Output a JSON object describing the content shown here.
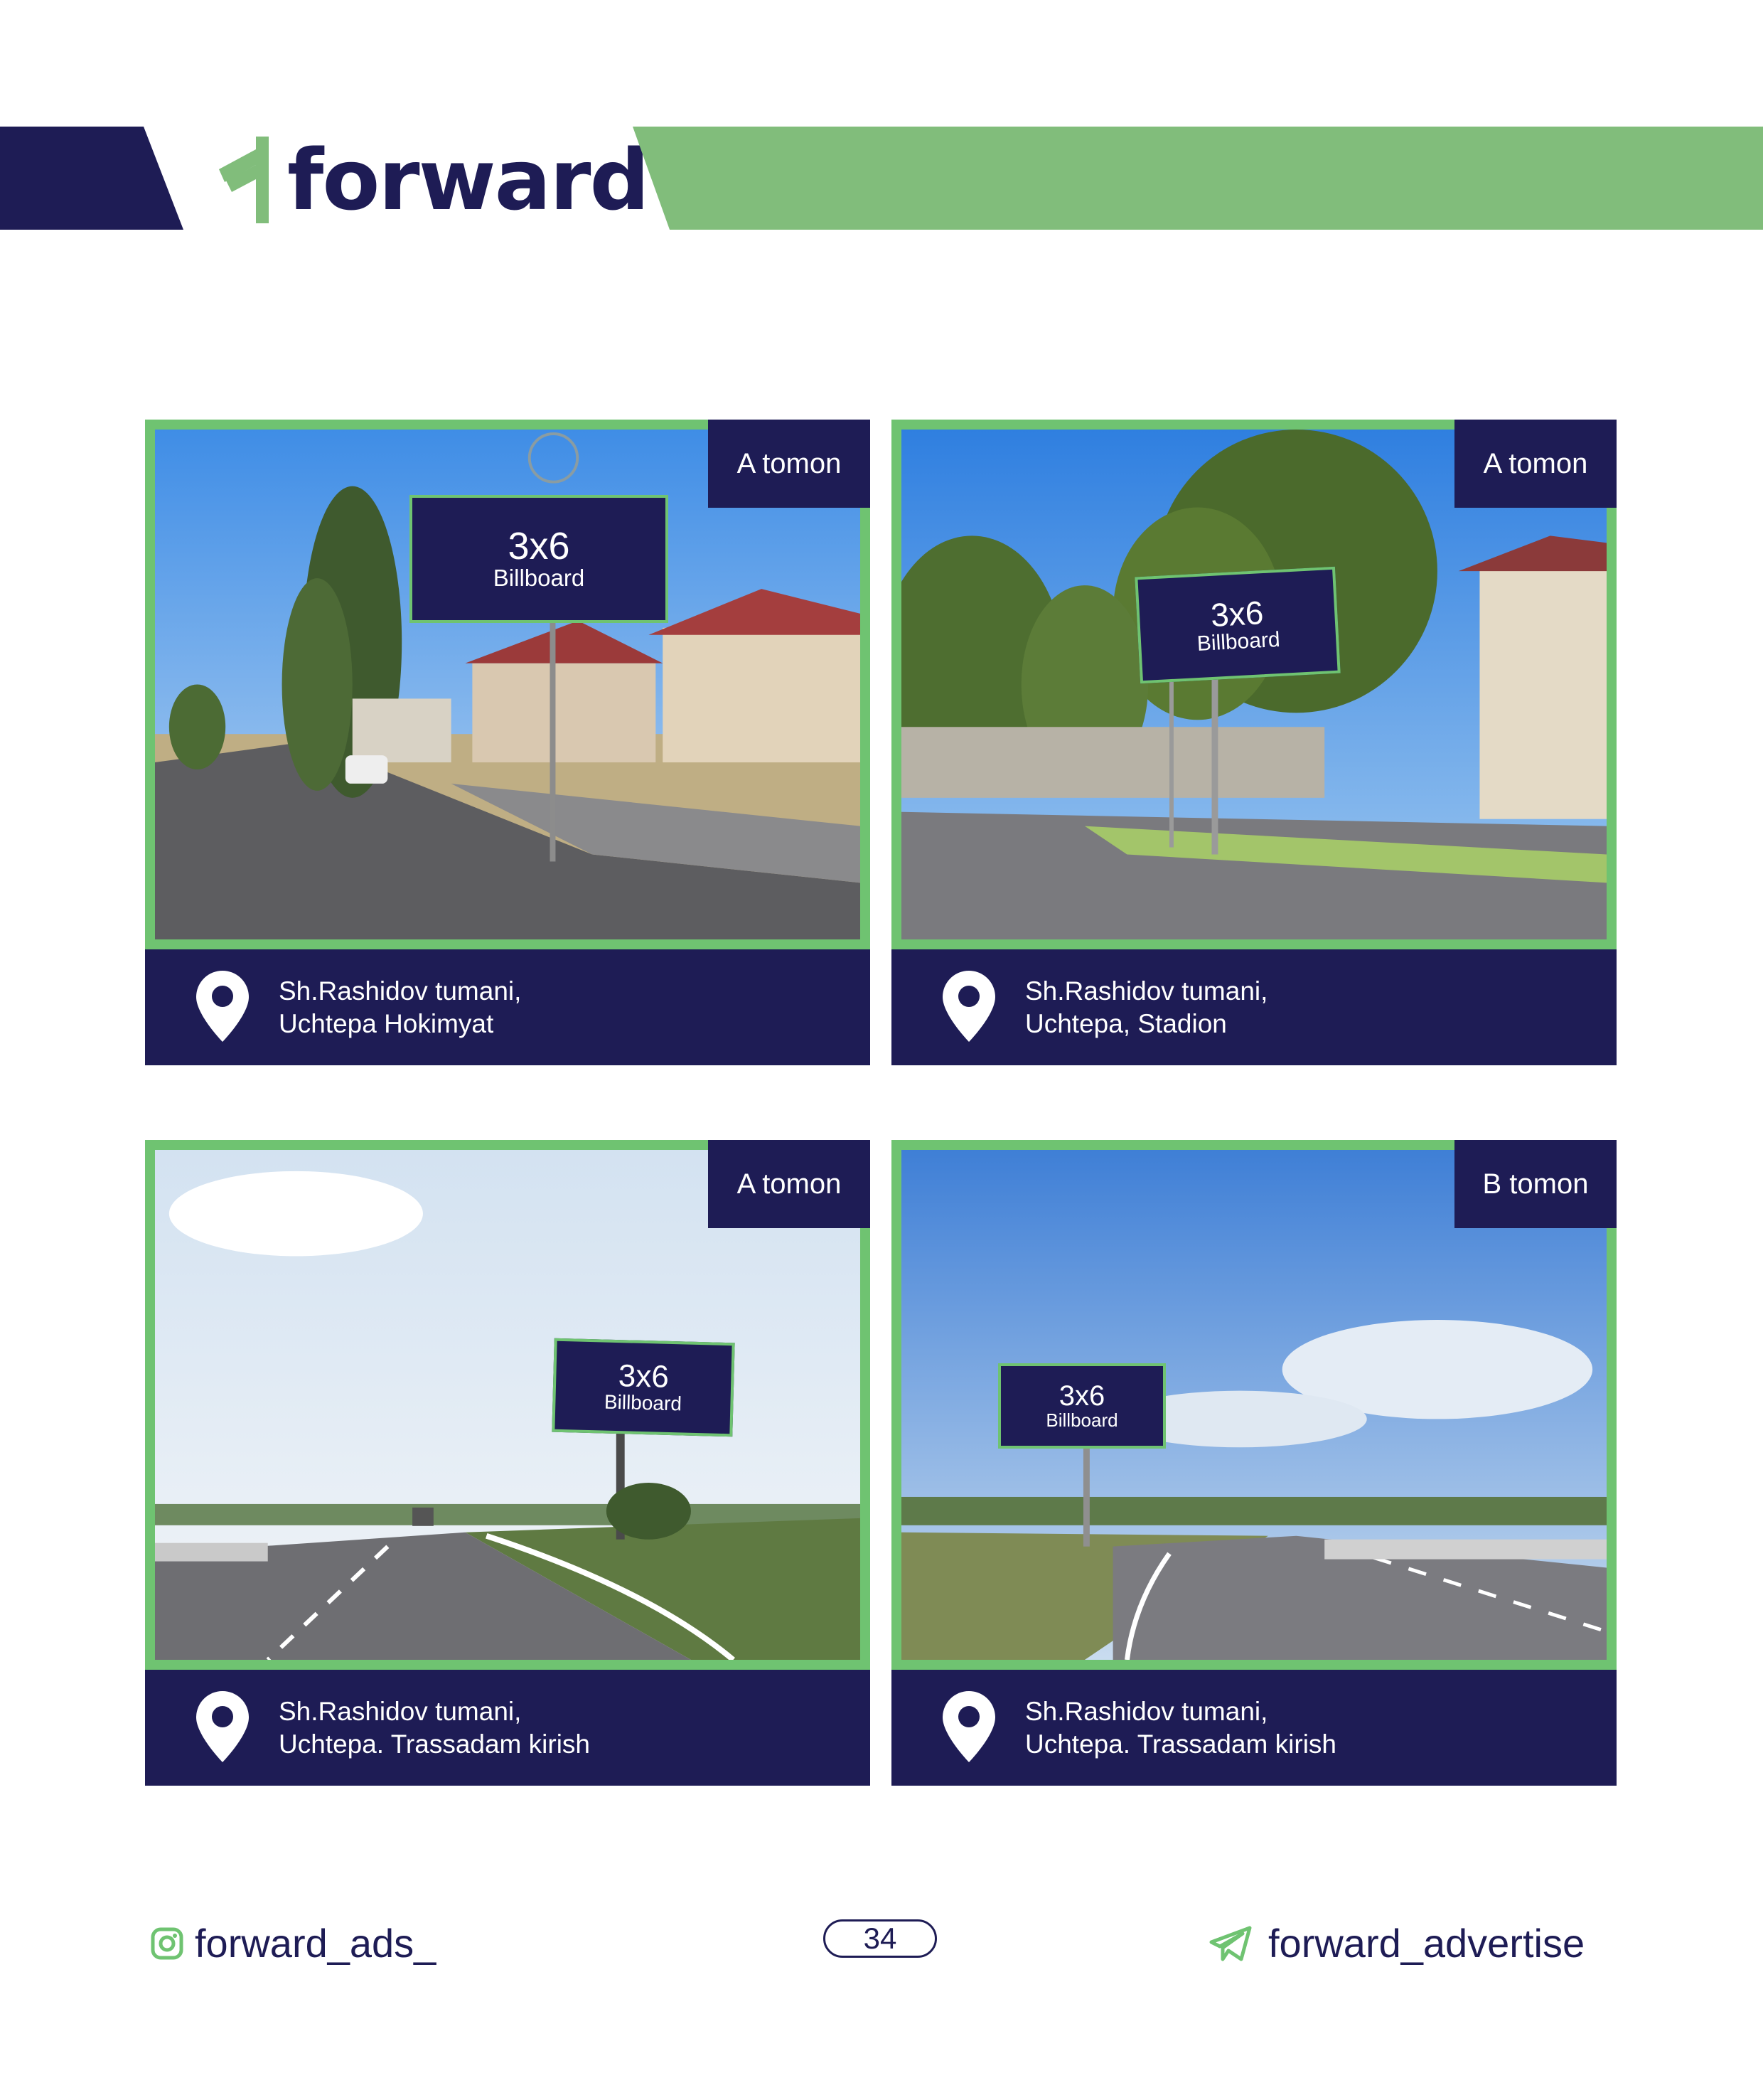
{
  "brand": {
    "name": "forward"
  },
  "colors": {
    "navy": "#1e1c55",
    "green": "#81bd7b",
    "frame_green": "#6fc371"
  },
  "cards": [
    {
      "side": "A tomon",
      "billboard_size": "3x6",
      "billboard_type": "Billboard",
      "address_line1": "Sh.Rashidov tumani,",
      "address_line2": "Uchtepa Hokimyat"
    },
    {
      "side": "A tomon",
      "billboard_size": "3x6",
      "billboard_type": "Billboard",
      "address_line1": "Sh.Rashidov tumani,",
      "address_line2": "Uchtepa, Stadion"
    },
    {
      "side": "A tomon",
      "billboard_size": "3x6",
      "billboard_type": "Billboard",
      "address_line1": "Sh.Rashidov tumani,",
      "address_line2": "Uchtepa. Trassadam kirish"
    },
    {
      "side": "B tomon",
      "billboard_size": "3x6",
      "billboard_type": "Billboard",
      "address_line1": "Sh.Rashidov tumani,",
      "address_line2": "Uchtepa. Trassadam kirish"
    }
  ],
  "footer": {
    "instagram_handle": "forward_ads_",
    "instagram_icon": "instagram-icon",
    "page_number": "34",
    "telegram_handle": "forward_advertise",
    "telegram_icon": "telegram-icon"
  }
}
